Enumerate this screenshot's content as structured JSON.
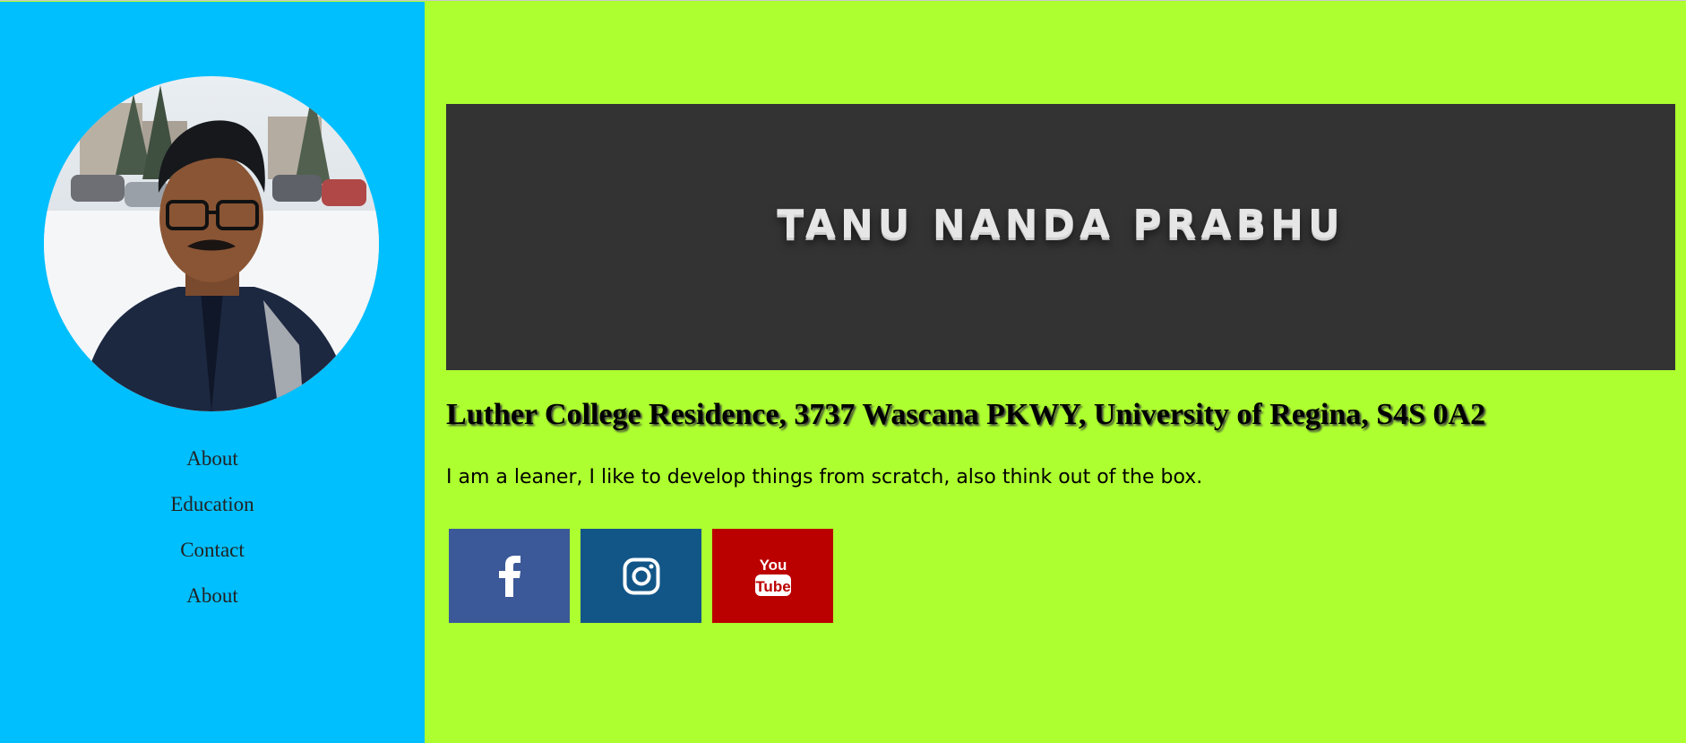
{
  "sidebar": {
    "avatar_icon": "profile-photo",
    "nav": [
      {
        "label": "About"
      },
      {
        "label": "Education"
      },
      {
        "label": "Contact"
      },
      {
        "label": "About"
      }
    ]
  },
  "banner": {
    "title": "TANU NANDA PRABHU"
  },
  "profile": {
    "address": "Luther College Residence, 3737 Wascana PKWY, University of Regina, S4S 0A2",
    "bio": "I am a leaner, I like to develop things from scratch, also think out of the box."
  },
  "social": [
    {
      "name": "facebook",
      "icon": "facebook-icon",
      "color": "#3b5998"
    },
    {
      "name": "instagram",
      "icon": "instagram-icon",
      "color": "#125688"
    },
    {
      "name": "youtube",
      "icon": "youtube-icon",
      "color": "#bb0000",
      "logo_text_top": "You",
      "logo_text_bottom": "Tube"
    }
  ],
  "colors": {
    "sidebar_bg": "#00bfff",
    "main_bg": "#adff2f",
    "banner_bg": "#333333"
  }
}
